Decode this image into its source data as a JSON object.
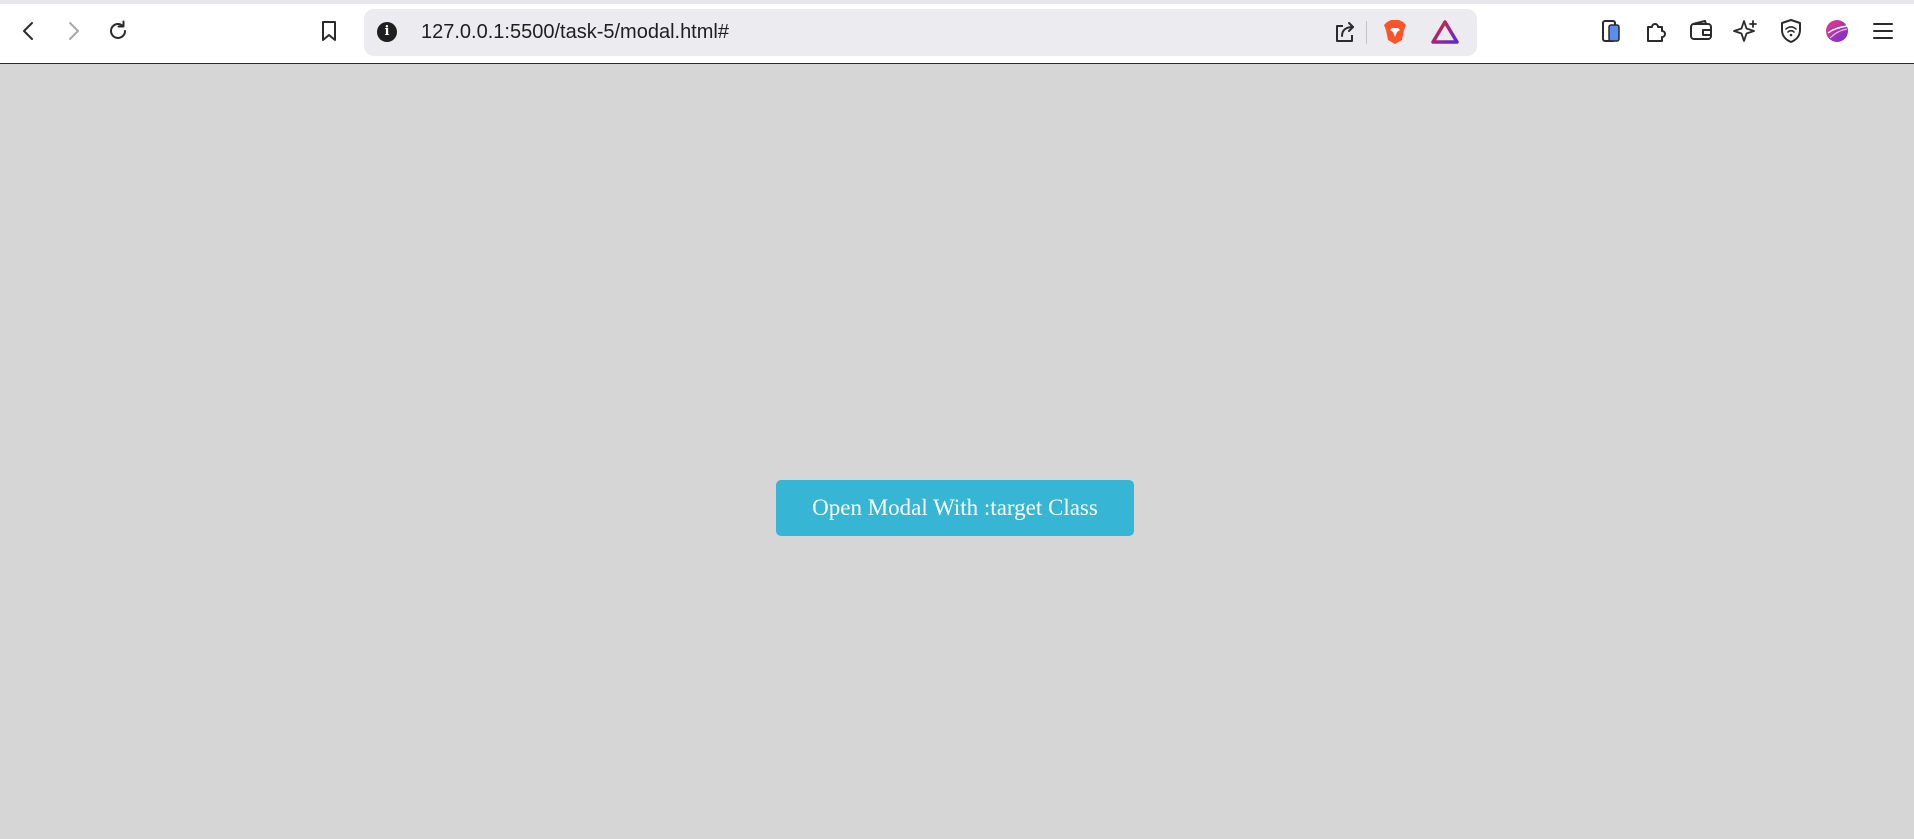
{
  "browser": {
    "url": "127.0.0.1:5500/task-5/modal.html#",
    "icons": {
      "back": "back-arrow-icon",
      "forward": "forward-arrow-icon",
      "reload": "reload-icon",
      "bookmark": "bookmark-icon",
      "site_info": "info-icon",
      "share": "share-icon",
      "brave_shield": "brave-lion-icon",
      "brave_rewards": "brave-rewards-triangle-icon",
      "tab_sidebar": "sidebar-icon",
      "extensions": "puzzle-icon",
      "wallet": "wallet-icon",
      "leo": "sparkle-icon",
      "vpn": "vpn-shield-icon",
      "profile": "profile-avatar-icon",
      "menu": "hamburger-menu-icon"
    },
    "info_glyph": "i",
    "colors": {
      "toolbar_bg": "#ffffff",
      "urlbar_bg": "#ececf0",
      "brave_orange": "#fb542b",
      "rewards_red": "#e2212c",
      "rewards_purple": "#5b2bd6"
    }
  },
  "page": {
    "background": "#d6d6d6",
    "open_modal_button": {
      "label": "Open Modal With :target Class",
      "color": "#36b5d4"
    }
  }
}
